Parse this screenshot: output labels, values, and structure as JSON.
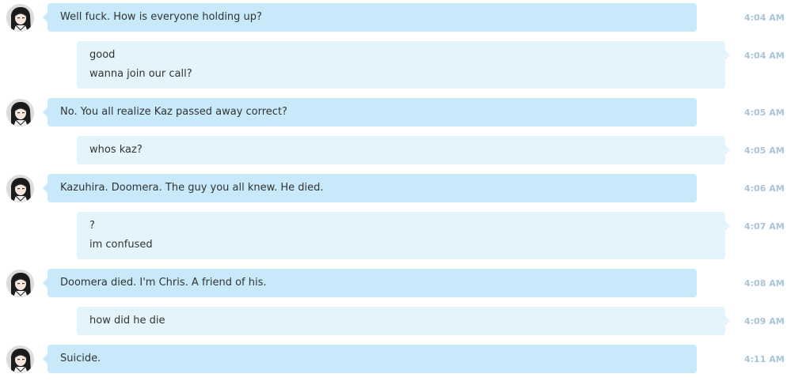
{
  "messages": [
    {
      "direction": "incoming",
      "lines": [
        "Well fuck. How is everyone holding up?"
      ],
      "time": "4:04 AM"
    },
    {
      "direction": "outgoing",
      "lines": [
        "good",
        "wanna join our call?"
      ],
      "time": "4:04 AM"
    },
    {
      "direction": "incoming",
      "lines": [
        "No. You all realize Kaz passed away correct?"
      ],
      "time": "4:05 AM"
    },
    {
      "direction": "outgoing",
      "lines": [
        "whos kaz?"
      ],
      "time": "4:05 AM"
    },
    {
      "direction": "incoming",
      "lines": [
        "Kazuhira. Doomera. The guy you all knew. He died."
      ],
      "time": "4:06 AM"
    },
    {
      "direction": "outgoing",
      "lines": [
        "?",
        "im confused"
      ],
      "time": "4:07 AM"
    },
    {
      "direction": "incoming",
      "lines": [
        "Doomera died. I'm Chris. A friend of his."
      ],
      "time": "4:08 AM"
    },
    {
      "direction": "outgoing",
      "lines": [
        "how did he die"
      ],
      "time": "4:09 AM"
    },
    {
      "direction": "incoming",
      "lines": [
        "Suicide."
      ],
      "time": "4:11 AM"
    }
  ],
  "colors": {
    "incoming_bubble": "#c7e9f9",
    "outgoing_bubble": "#e3f4fc",
    "timestamp": "#a9c4d6",
    "text": "#333333"
  },
  "icons": {
    "avatar": "anime-avatar-icon"
  }
}
